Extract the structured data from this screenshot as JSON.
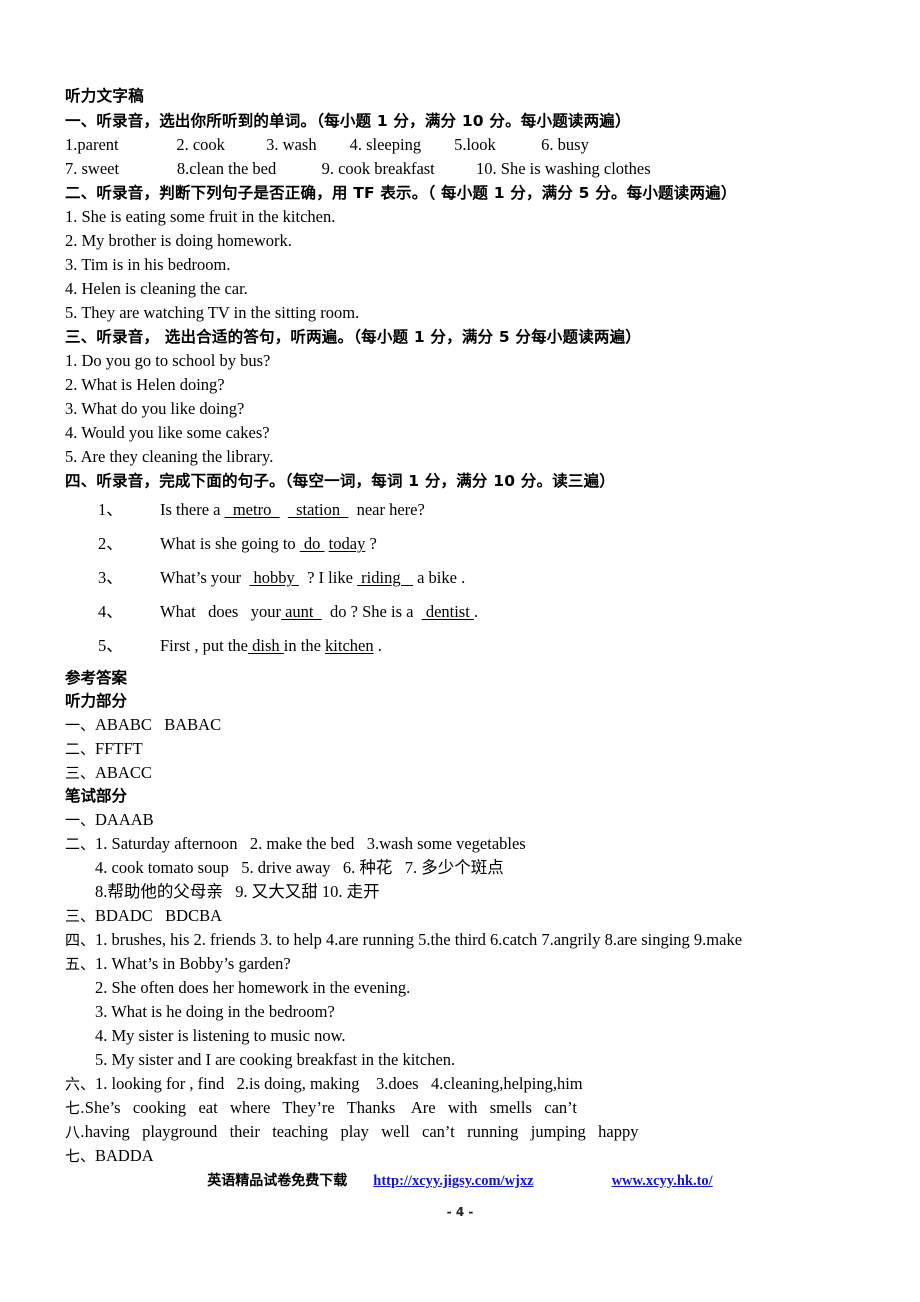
{
  "document": {
    "title": "听力文字稿",
    "page_number": "- 4 -"
  },
  "listening_script": {
    "section_one": {
      "heading": "一、听录音，选出你所听到的单词。（每小题 1 分，满分 10 分。每小题读两遍）",
      "row1": "1.parent              2. cook          3. wash        4. sleeping        5.look           6. busy",
      "row2": "7. sweet              8.clean the bed           9. cook breakfast          10. She is washing clothes"
    },
    "section_two": {
      "heading": "二、听录音，判断下列句子是否正确，用 TF 表示。（ 每小题 1 分，满分 5 分。每小题读两遍）",
      "items": [
        "1. She is eating some fruit in the kitchen.",
        "2. My brother is doing homework.",
        "3. Tim is in his bedroom.",
        "4. Helen is cleaning the car.",
        "5. They are watching TV in the sitting room."
      ]
    },
    "section_three": {
      "heading": "三、听录音， 选出合适的答句，听两遍。（每小题 1 分，满分 5 分每小题读两遍）",
      "items": [
        "1. Do you go to school by bus?",
        "2. What is Helen doing?",
        "3. What do you like doing?",
        "4. Would you like some cakes?",
        "5. Are they cleaning the library."
      ]
    },
    "section_four": {
      "heading": "四、听录音，完成下面的句子。（每空一词，每词 1 分，满分 10 分。读三遍）",
      "items": [
        {
          "number": "1、",
          "parts": [
            {
              "t": "Is there a ",
              "blank": false
            },
            {
              "t": "  metro  ",
              "blank": true
            },
            {
              "t": "  ",
              "blank": false
            },
            {
              "t": "  station  ",
              "blank": true
            },
            {
              "t": "  near here?",
              "blank": false
            }
          ]
        },
        {
          "number": "2、",
          "parts": [
            {
              "t": "What is she going to ",
              "blank": false
            },
            {
              "t": " do ",
              "blank": true
            },
            {
              "t": " ",
              "blank": false
            },
            {
              "t": "today",
              "blank": true
            },
            {
              "t": " ?",
              "blank": false
            }
          ]
        },
        {
          "number": "3、",
          "parts": [
            {
              "t": "What’s your  ",
              "blank": false
            },
            {
              "t": " hobby ",
              "blank": true
            },
            {
              "t": "  ? I like ",
              "blank": false
            },
            {
              "t": " riding   ",
              "blank": true
            },
            {
              "t": " a bike .",
              "blank": false
            }
          ]
        },
        {
          "number": "4、",
          "parts": [
            {
              "t": "What   does   your",
              "blank": false
            },
            {
              "t": " aunt  ",
              "blank": true
            },
            {
              "t": "  do ? She is a  ",
              "blank": false
            },
            {
              "t": " dentist ",
              "blank": true
            },
            {
              "t": ".",
              "blank": false
            }
          ]
        },
        {
          "number": "5、",
          "parts": [
            {
              "t": "First , put the",
              "blank": false
            },
            {
              "t": " dish ",
              "blank": true
            },
            {
              "t": "in the ",
              "blank": false
            },
            {
              "t": "kitchen",
              "blank": true
            },
            {
              "t": " .",
              "blank": false
            }
          ]
        }
      ]
    }
  },
  "answer_key": {
    "title": "参考答案",
    "listening_part_title": "听力部分",
    "listening_answers": [
      {
        "marker": "一、",
        "text": "ABABC   BABAC"
      },
      {
        "marker": "二、",
        "text": "FFTFT"
      },
      {
        "marker": "三、",
        "text": "ABACC"
      }
    ],
    "written_part_title": "笔试部分",
    "written_answers": [
      {
        "marker": "一、",
        "text": "DAAAB",
        "sub": []
      },
      {
        "marker": "二、",
        "text": "1. Saturday afternoon   2. make the bed   3.wash some vegetables",
        "sub": [
          "4. cook tomato soup   5. drive away   6. 种花   7. 多少个斑点",
          "8.帮助他的父母亲   9. 又大又甜 10. 走开"
        ]
      },
      {
        "marker": "三、",
        "text": "BDADC   BDCBA",
        "sub": []
      },
      {
        "marker": "四、",
        "text": "1. brushes, his 2. friends 3. to help 4.are running 5.the third 6.catch 7.angrily 8.are singing 9.make",
        "sub": []
      },
      {
        "marker": "五、",
        "text": "1. What’s in Bobby’s garden?",
        "sub": [
          "2. She often does her homework in the evening.",
          "3. What is he doing in the bedroom?",
          "4. My sister is listening to music now.",
          "5. My sister and I are cooking breakfast in the kitchen."
        ]
      },
      {
        "marker": "六、",
        "text": "1. looking for , find   2.is doing, making    3.does   4.cleaning,helping,him",
        "sub": []
      },
      {
        "marker": "七.",
        "text": "She’s   cooking   eat   where   They’re   Thanks    Are   with   smells   can’t",
        "sub": []
      },
      {
        "marker": "八.",
        "text": "having   playground   their   teaching   play   well   can’t   running   jumping   happy",
        "sub": []
      },
      {
        "marker": "七、",
        "text": "BADDA",
        "sub": []
      }
    ]
  },
  "footer": {
    "promo_text": "英语精品试卷免费下载",
    "link1": "http://xcyy.jigsy.com/wjxz",
    "link2": "www.xcyy.hk.to/",
    "link_color": "#1414cc"
  }
}
